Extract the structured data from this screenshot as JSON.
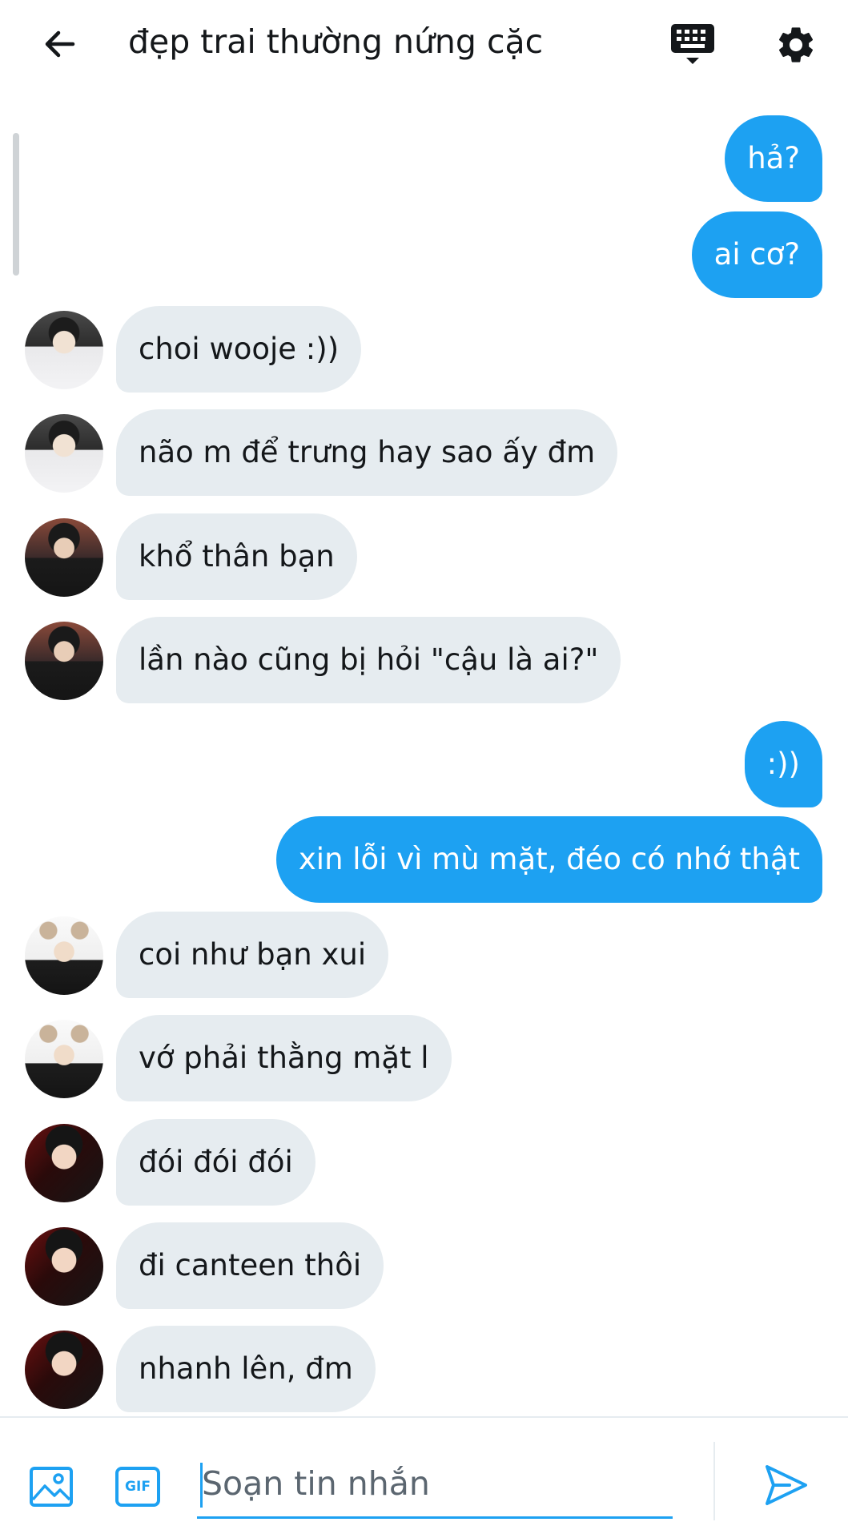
{
  "header": {
    "title": "đẹp trai thường nứng cặc",
    "back_icon": "arrow-left-icon",
    "keyboard_icon": "keyboard-icon",
    "settings_icon": "gear-icon"
  },
  "messages": [
    {
      "direction": "out",
      "text": "hả?"
    },
    {
      "direction": "out",
      "text": "ai cơ?"
    },
    {
      "direction": "in",
      "text": "choi wooje :))"
    },
    {
      "direction": "in",
      "text": "não m để trưng hay sao ấy đm"
    },
    {
      "direction": "in",
      "text": "khổ thân bạn"
    },
    {
      "direction": "in",
      "text": "lần nào cũng bị hỏi \"cậu là ai?\""
    },
    {
      "direction": "out",
      "text": ":))"
    },
    {
      "direction": "out",
      "text": "xin lỗi vì mù mặt, đéo có nhớ thật"
    },
    {
      "direction": "in",
      "text": "coi như bạn xui"
    },
    {
      "direction": "in",
      "text": "vớ phải thằng mặt l"
    },
    {
      "direction": "in",
      "text": "đói đói đói"
    },
    {
      "direction": "in",
      "text": "đi canteen thôi"
    },
    {
      "direction": "in",
      "text": "nhanh lên, đm"
    }
  ],
  "composer": {
    "placeholder": "Soạn tin nhắn",
    "value": "",
    "media_icon": "image-icon",
    "gif_label": "GIF",
    "send_icon": "send-icon"
  },
  "colors": {
    "accent": "#1da1f2",
    "incoming_bubble": "#e6ecf0",
    "text": "#14171a"
  }
}
